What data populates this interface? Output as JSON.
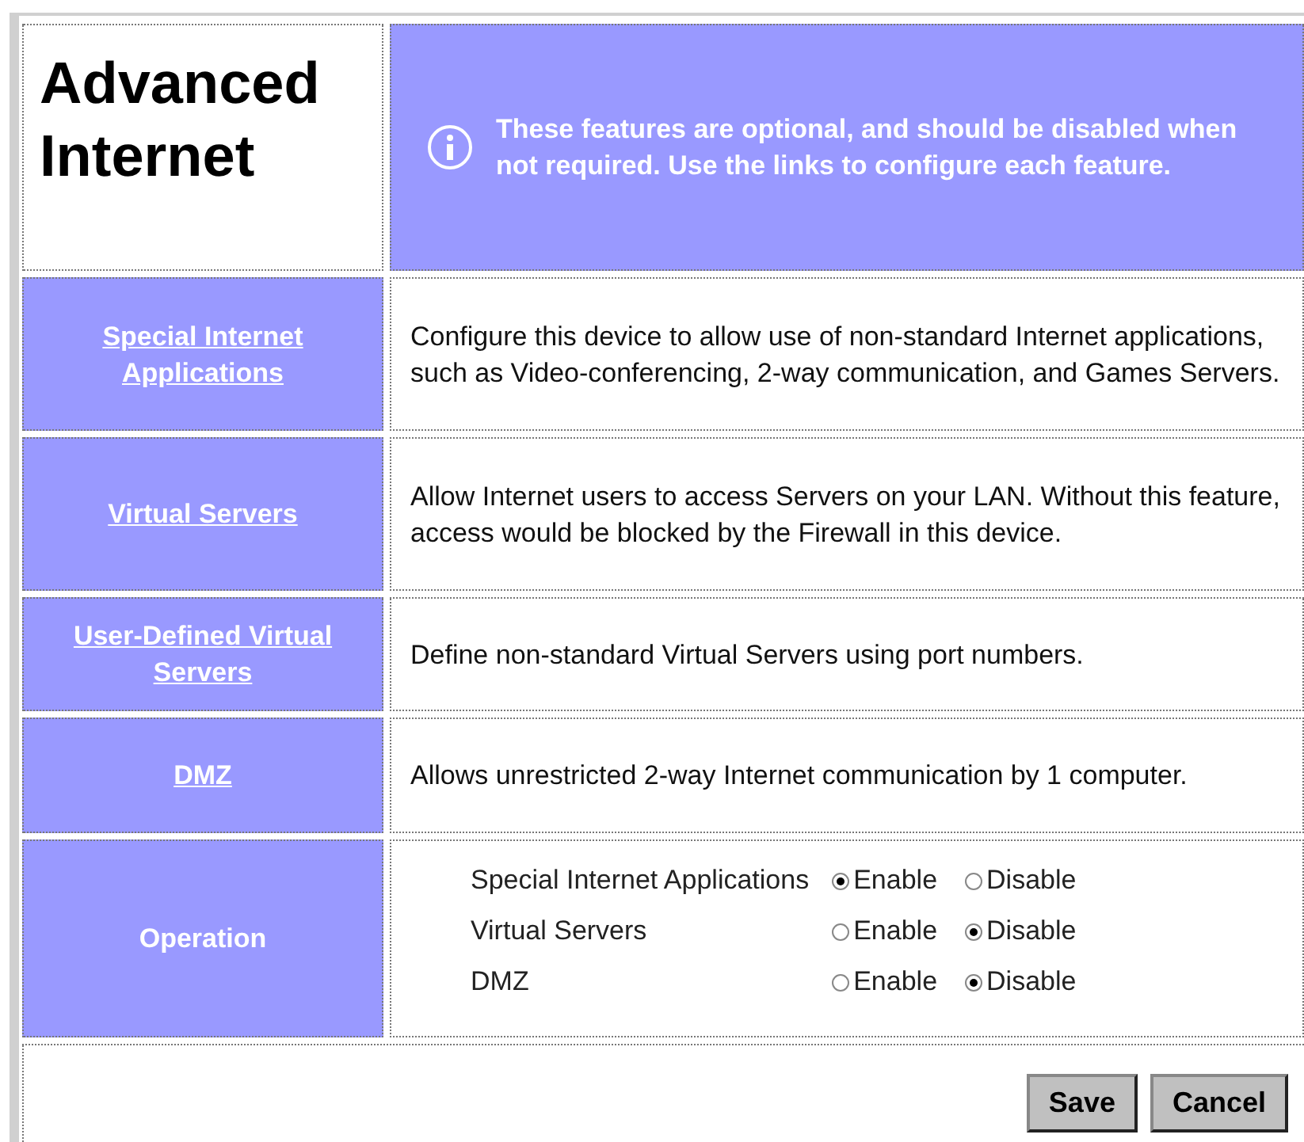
{
  "title": "Advanced Internet",
  "notice": "These features are optional, and should be disabled when not required. Use the links to configure each feature.",
  "features": [
    {
      "link": "Special Internet Applications",
      "description": "Configure this device to allow use of non-standard Internet applications, such as Video-conferencing, 2-way communication, and Games Servers."
    },
    {
      "link": "Virtual Servers",
      "description": "Allow Internet users to access Servers on your LAN. Without this feature, access would be blocked by the Firewall in this device."
    },
    {
      "link": "User-Defined Virtual Servers",
      "description": "Define non-standard Virtual Servers using port numbers."
    },
    {
      "link": "DMZ",
      "description": "Allows unrestricted 2-way Internet communication by 1 computer."
    }
  ],
  "operation": {
    "label": "Operation",
    "rows": [
      {
        "name": "Special Internet Applications",
        "options": [
          {
            "label": "Enable",
            "selected": true
          },
          {
            "label": "Disable",
            "selected": false
          }
        ]
      },
      {
        "name": "Virtual Servers",
        "options": [
          {
            "label": "Enable",
            "selected": false
          },
          {
            "label": "Disable",
            "selected": true
          }
        ]
      },
      {
        "name": "DMZ",
        "options": [
          {
            "label": "Enable",
            "selected": false
          },
          {
            "label": "Disable",
            "selected": true
          }
        ]
      }
    ]
  },
  "buttons": [
    "Save",
    "Cancel"
  ]
}
